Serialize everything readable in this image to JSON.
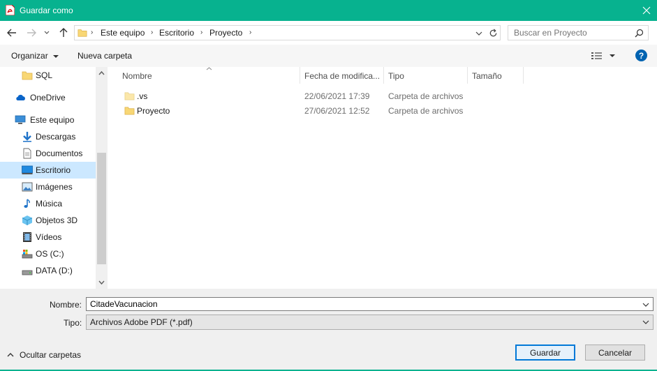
{
  "window": {
    "title": "Guardar como",
    "accent": "#07b28f"
  },
  "nav": {
    "path": [
      "Este equipo",
      "Escritorio",
      "Proyecto"
    ],
    "search_placeholder": "Buscar en Proyecto"
  },
  "toolbar": {
    "organize_label": "Organizar",
    "new_folder_label": "Nueva carpeta"
  },
  "sidebar": {
    "items": [
      {
        "label": "SQL",
        "icon": "folder-icon"
      },
      {
        "label": "OneDrive",
        "icon": "cloud-icon"
      },
      {
        "label": "Este equipo",
        "icon": "computer-icon"
      },
      {
        "label": "Descargas",
        "icon": "download-icon"
      },
      {
        "label": "Documentos",
        "icon": "document-icon"
      },
      {
        "label": "Escritorio",
        "icon": "desktop-icon"
      },
      {
        "label": "Imágenes",
        "icon": "image-icon"
      },
      {
        "label": "Música",
        "icon": "music-icon"
      },
      {
        "label": "Objetos 3D",
        "icon": "cube-icon"
      },
      {
        "label": "Vídeos",
        "icon": "video-icon"
      },
      {
        "label": "OS (C:)",
        "icon": "drive-icon"
      },
      {
        "label": "DATA (D:)",
        "icon": "drive-icon"
      }
    ]
  },
  "filelist": {
    "columns": [
      "Nombre",
      "Fecha de modifica...",
      "Tipo",
      "Tamaño"
    ],
    "rows": [
      {
        "name": ".vs",
        "date": "22/06/2021 17:39",
        "type": "Carpeta de archivos"
      },
      {
        "name": "Proyecto",
        "date": "27/06/2021 12:52",
        "type": "Carpeta de archivos"
      }
    ]
  },
  "form": {
    "name_label": "Nombre:",
    "name_value": "CitadeVacunacion",
    "type_label": "Tipo:",
    "type_value": "Archivos Adobe PDF (*.pdf)",
    "save_label": "Guardar",
    "cancel_label": "Cancelar",
    "hide_folders_label": "Ocultar carpetas"
  }
}
